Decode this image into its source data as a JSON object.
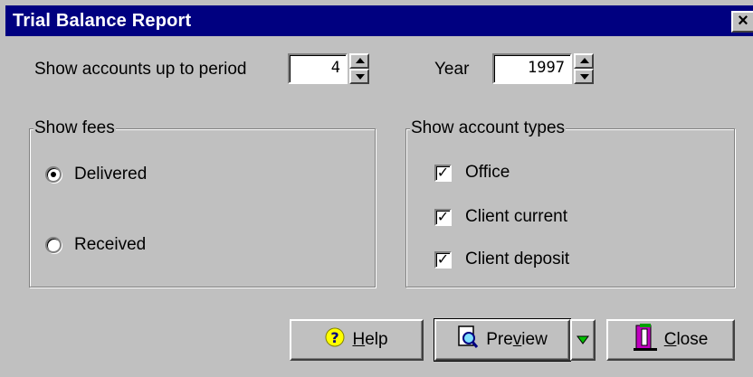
{
  "window": {
    "title": "Trial Balance Report",
    "close_glyph": "✕"
  },
  "period": {
    "label": "Show accounts up to period",
    "value": "4"
  },
  "year": {
    "label": "Year",
    "value": "1997"
  },
  "fees": {
    "legend": "Show fees",
    "options": [
      {
        "label": "Delivered",
        "selected": true
      },
      {
        "label": "Received",
        "selected": false
      }
    ]
  },
  "account_types": {
    "legend": "Show account types",
    "options": [
      {
        "label": "Office",
        "checked": true
      },
      {
        "label": "Client current",
        "checked": true
      },
      {
        "label": "Client deposit",
        "checked": true
      }
    ]
  },
  "buttons": {
    "help": {
      "label_hotkey": "H",
      "label_rest": "elp",
      "icon": "question-icon"
    },
    "preview": {
      "label_pre": "Pre",
      "label_hotkey": "v",
      "label_rest": "iew",
      "icon": "magnifier-document-icon"
    },
    "close": {
      "label_hotkey": "C",
      "label_rest": "lose",
      "icon": "door-exit-icon"
    }
  },
  "colors": {
    "titlebar": "#000080",
    "face": "#c0c0c0",
    "help_icon_bg": "#ffff00",
    "help_icon_fg": "#000080",
    "dropdown_arrow": "#00c000"
  }
}
